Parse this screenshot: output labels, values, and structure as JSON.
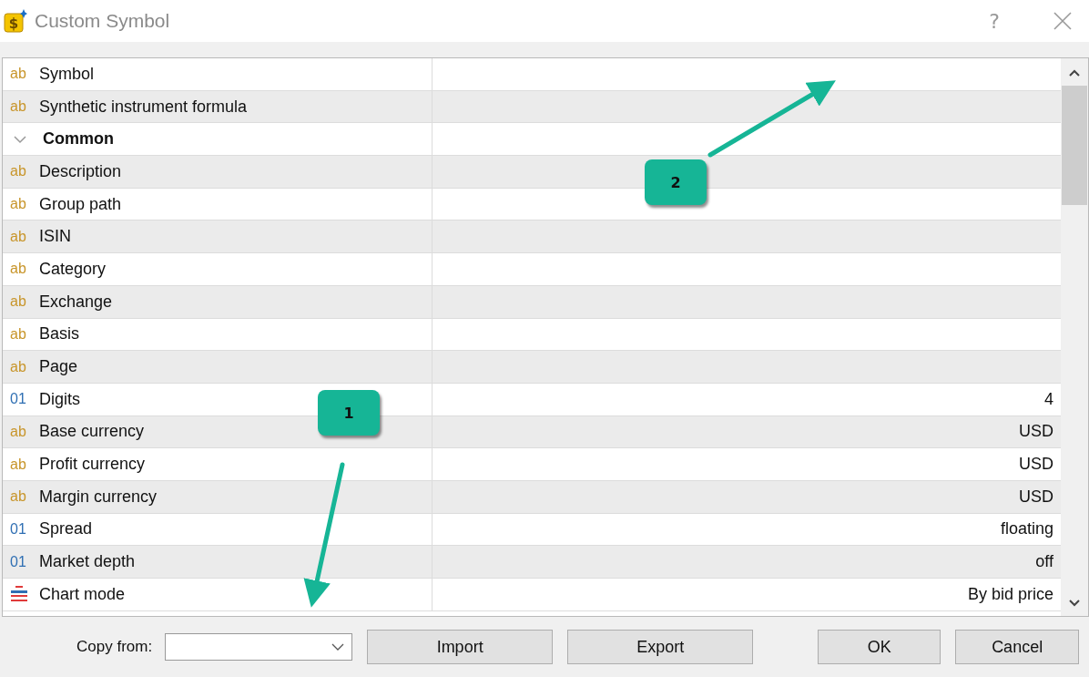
{
  "window": {
    "title": "Custom Symbol",
    "icon_glyph": "$",
    "help": "?"
  },
  "properties": [
    {
      "kind": "text",
      "type_mark": "ab",
      "name": "Symbol"
    },
    {
      "kind": "text",
      "type_mark": "ab",
      "name": "Synthetic instrument formula"
    },
    {
      "kind": "group",
      "name": "Common",
      "expanded": true
    },
    {
      "kind": "text",
      "type_mark": "ab",
      "name": "Description"
    },
    {
      "kind": "text",
      "type_mark": "ab",
      "name": "Group path"
    },
    {
      "kind": "text",
      "type_mark": "ab",
      "name": "ISIN"
    },
    {
      "kind": "text",
      "type_mark": "ab",
      "name": "Category"
    },
    {
      "kind": "text",
      "type_mark": "ab",
      "name": "Exchange"
    },
    {
      "kind": "text",
      "type_mark": "ab",
      "name": "Basis"
    },
    {
      "kind": "text",
      "type_mark": "ab",
      "name": "Page"
    },
    {
      "kind": "number",
      "type_mark": "01",
      "name": "Digits",
      "value": "4"
    },
    {
      "kind": "text",
      "type_mark": "ab",
      "name": "Base currency",
      "value": "USD"
    },
    {
      "kind": "text",
      "type_mark": "ab",
      "name": "Profit currency",
      "value": "USD"
    },
    {
      "kind": "text",
      "type_mark": "ab",
      "name": "Margin currency",
      "value": "USD"
    },
    {
      "kind": "number",
      "type_mark": "01",
      "name": "Spread",
      "value": "floating"
    },
    {
      "kind": "number",
      "type_mark": "01",
      "name": "Market depth",
      "value": "off"
    },
    {
      "kind": "list",
      "name": "Chart mode",
      "value": "By bid price"
    }
  ],
  "footer": {
    "copy_from_label": "Copy from:",
    "buttons": [
      "Import",
      "Export",
      "OK",
      "Cancel"
    ]
  },
  "callouts": [
    {
      "label": "1"
    },
    {
      "label": "2"
    }
  ]
}
